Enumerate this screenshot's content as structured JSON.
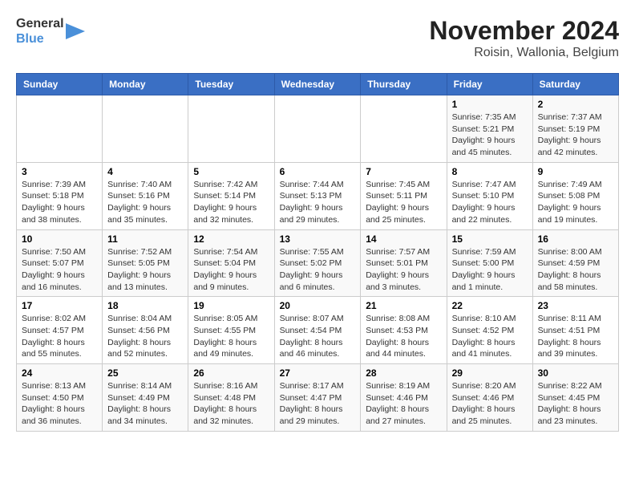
{
  "logo": {
    "line1": "General",
    "line2": "Blue"
  },
  "title": "November 2024",
  "subtitle": "Roisin, Wallonia, Belgium",
  "days_of_week": [
    "Sunday",
    "Monday",
    "Tuesday",
    "Wednesday",
    "Thursday",
    "Friday",
    "Saturday"
  ],
  "weeks": [
    [
      {
        "day": "",
        "info": ""
      },
      {
        "day": "",
        "info": ""
      },
      {
        "day": "",
        "info": ""
      },
      {
        "day": "",
        "info": ""
      },
      {
        "day": "",
        "info": ""
      },
      {
        "day": "1",
        "info": "Sunrise: 7:35 AM\nSunset: 5:21 PM\nDaylight: 9 hours and 45 minutes."
      },
      {
        "day": "2",
        "info": "Sunrise: 7:37 AM\nSunset: 5:19 PM\nDaylight: 9 hours and 42 minutes."
      }
    ],
    [
      {
        "day": "3",
        "info": "Sunrise: 7:39 AM\nSunset: 5:18 PM\nDaylight: 9 hours and 38 minutes."
      },
      {
        "day": "4",
        "info": "Sunrise: 7:40 AM\nSunset: 5:16 PM\nDaylight: 9 hours and 35 minutes."
      },
      {
        "day": "5",
        "info": "Sunrise: 7:42 AM\nSunset: 5:14 PM\nDaylight: 9 hours and 32 minutes."
      },
      {
        "day": "6",
        "info": "Sunrise: 7:44 AM\nSunset: 5:13 PM\nDaylight: 9 hours and 29 minutes."
      },
      {
        "day": "7",
        "info": "Sunrise: 7:45 AM\nSunset: 5:11 PM\nDaylight: 9 hours and 25 minutes."
      },
      {
        "day": "8",
        "info": "Sunrise: 7:47 AM\nSunset: 5:10 PM\nDaylight: 9 hours and 22 minutes."
      },
      {
        "day": "9",
        "info": "Sunrise: 7:49 AM\nSunset: 5:08 PM\nDaylight: 9 hours and 19 minutes."
      }
    ],
    [
      {
        "day": "10",
        "info": "Sunrise: 7:50 AM\nSunset: 5:07 PM\nDaylight: 9 hours and 16 minutes."
      },
      {
        "day": "11",
        "info": "Sunrise: 7:52 AM\nSunset: 5:05 PM\nDaylight: 9 hours and 13 minutes."
      },
      {
        "day": "12",
        "info": "Sunrise: 7:54 AM\nSunset: 5:04 PM\nDaylight: 9 hours and 9 minutes."
      },
      {
        "day": "13",
        "info": "Sunrise: 7:55 AM\nSunset: 5:02 PM\nDaylight: 9 hours and 6 minutes."
      },
      {
        "day": "14",
        "info": "Sunrise: 7:57 AM\nSunset: 5:01 PM\nDaylight: 9 hours and 3 minutes."
      },
      {
        "day": "15",
        "info": "Sunrise: 7:59 AM\nSunset: 5:00 PM\nDaylight: 9 hours and 1 minute."
      },
      {
        "day": "16",
        "info": "Sunrise: 8:00 AM\nSunset: 4:59 PM\nDaylight: 8 hours and 58 minutes."
      }
    ],
    [
      {
        "day": "17",
        "info": "Sunrise: 8:02 AM\nSunset: 4:57 PM\nDaylight: 8 hours and 55 minutes."
      },
      {
        "day": "18",
        "info": "Sunrise: 8:04 AM\nSunset: 4:56 PM\nDaylight: 8 hours and 52 minutes."
      },
      {
        "day": "19",
        "info": "Sunrise: 8:05 AM\nSunset: 4:55 PM\nDaylight: 8 hours and 49 minutes."
      },
      {
        "day": "20",
        "info": "Sunrise: 8:07 AM\nSunset: 4:54 PM\nDaylight: 8 hours and 46 minutes."
      },
      {
        "day": "21",
        "info": "Sunrise: 8:08 AM\nSunset: 4:53 PM\nDaylight: 8 hours and 44 minutes."
      },
      {
        "day": "22",
        "info": "Sunrise: 8:10 AM\nSunset: 4:52 PM\nDaylight: 8 hours and 41 minutes."
      },
      {
        "day": "23",
        "info": "Sunrise: 8:11 AM\nSunset: 4:51 PM\nDaylight: 8 hours and 39 minutes."
      }
    ],
    [
      {
        "day": "24",
        "info": "Sunrise: 8:13 AM\nSunset: 4:50 PM\nDaylight: 8 hours and 36 minutes."
      },
      {
        "day": "25",
        "info": "Sunrise: 8:14 AM\nSunset: 4:49 PM\nDaylight: 8 hours and 34 minutes."
      },
      {
        "day": "26",
        "info": "Sunrise: 8:16 AM\nSunset: 4:48 PM\nDaylight: 8 hours and 32 minutes."
      },
      {
        "day": "27",
        "info": "Sunrise: 8:17 AM\nSunset: 4:47 PM\nDaylight: 8 hours and 29 minutes."
      },
      {
        "day": "28",
        "info": "Sunrise: 8:19 AM\nSunset: 4:46 PM\nDaylight: 8 hours and 27 minutes."
      },
      {
        "day": "29",
        "info": "Sunrise: 8:20 AM\nSunset: 4:46 PM\nDaylight: 8 hours and 25 minutes."
      },
      {
        "day": "30",
        "info": "Sunrise: 8:22 AM\nSunset: 4:45 PM\nDaylight: 8 hours and 23 minutes."
      }
    ]
  ]
}
